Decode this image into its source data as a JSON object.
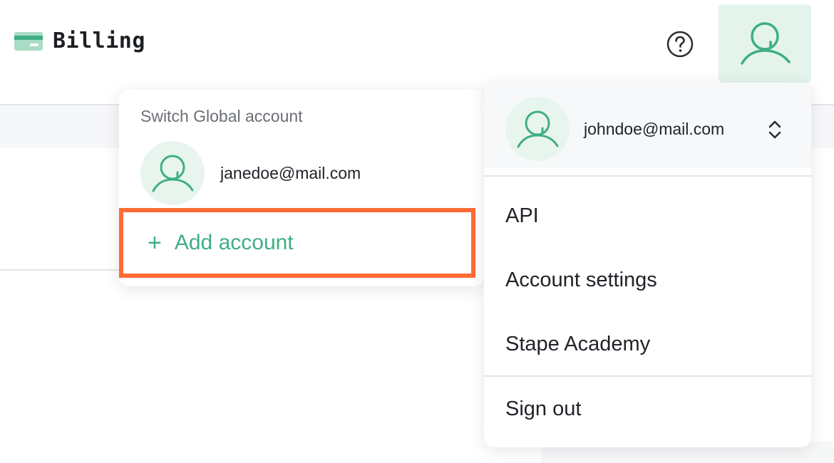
{
  "header": {
    "title": "Billing",
    "title_icon": "credit-card-icon",
    "help_icon": "help-circle-icon",
    "avatar_icon": "user-avatar-icon"
  },
  "switch_menu": {
    "heading": "Switch Global account",
    "accounts": [
      {
        "email": "janedoe@mail.com",
        "icon": "user-avatar-icon"
      }
    ],
    "add_account_label": "Add account",
    "add_icon": "plus-icon"
  },
  "user_menu": {
    "current_email": "johndoe@mail.com",
    "switch_icon": "chevron-up-down-icon",
    "items": [
      {
        "label": "API"
      },
      {
        "label": "Account settings"
      },
      {
        "label": "Stape Academy"
      }
    ],
    "sign_out_label": "Sign out"
  },
  "colors": {
    "accent_green": "#3fae84",
    "avatar_bg": "#e8f5ee",
    "highlight_orange": "#ff6b35"
  }
}
